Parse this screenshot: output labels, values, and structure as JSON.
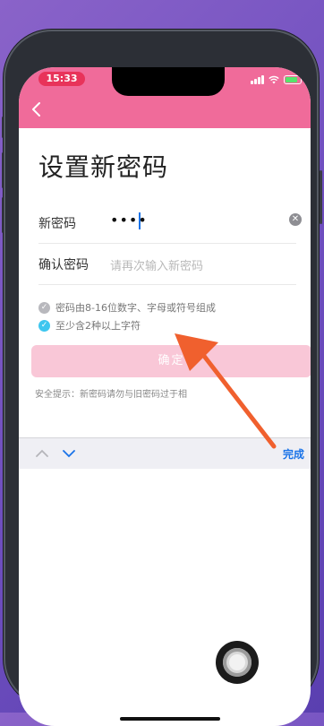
{
  "status_bar": {
    "time": "15:33"
  },
  "page": {
    "title": "设置新密码"
  },
  "form": {
    "new_password_label": "新密码",
    "new_password_value": "••••",
    "confirm_label": "确认密码",
    "confirm_placeholder": "请再次输入新密码"
  },
  "rules": [
    {
      "text": "密码由8-16位数字、字母或符号组成",
      "checked": false
    },
    {
      "text": "至少含2种以上字符",
      "checked": true
    }
  ],
  "confirm_button": {
    "label": "确定"
  },
  "tip": {
    "text": "安全提示：新密码请勿与旧密码过于相"
  },
  "keyboard_toolbar": {
    "done_label": "完成"
  },
  "colors": {
    "header": "#f06b9a",
    "confirm_button_disabled": "#f9c7d7",
    "check_active": "#3ec6ef",
    "arrow": "#f0602e",
    "link": "#1a73e8"
  },
  "icons": [
    "back-arrow-icon",
    "clear-icon",
    "check-icon",
    "chevron-up-icon",
    "chevron-down-icon",
    "signal-icon",
    "wifi-icon",
    "battery-icon"
  ]
}
